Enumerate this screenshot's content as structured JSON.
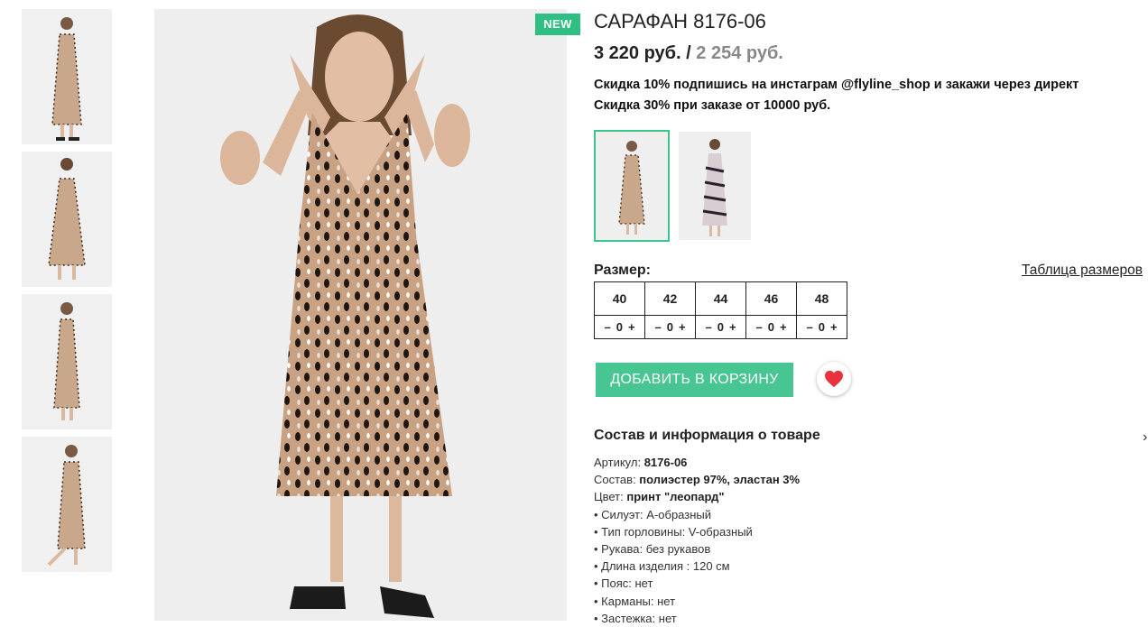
{
  "badge": {
    "new": "NEW"
  },
  "product": {
    "title": "САРАФАН 8176-06",
    "price_current": "3 220 руб.",
    "price_separator": " / ",
    "price_old": "2 254 руб."
  },
  "promo": {
    "line1": "Скидка 10% подпишись на инстаграм @flyline_shop и закажи через директ",
    "line2": "Скидка 30% при заказе от 10000 руб."
  },
  "size": {
    "label": "Размер:",
    "chart_link": "Таблица размеров",
    "options": [
      {
        "size": "40",
        "minus": "–",
        "qty": "0",
        "plus": "+"
      },
      {
        "size": "42",
        "minus": "–",
        "qty": "0",
        "plus": "+"
      },
      {
        "size": "44",
        "minus": "–",
        "qty": "0",
        "plus": "+"
      },
      {
        "size": "46",
        "minus": "–",
        "qty": "0",
        "plus": "+"
      },
      {
        "size": "48",
        "minus": "–",
        "qty": "0",
        "plus": "+"
      }
    ]
  },
  "actions": {
    "add_to_cart": "ДОБАВИТЬ В КОРЗИНУ"
  },
  "info": {
    "section_title": "Состав и информация о товаре",
    "chevron": "›",
    "article_label": "Артикул: ",
    "article_value": "8176-06",
    "composition_label": "Состав: ",
    "composition_value": "полиэстер 97%, эластан 3%",
    "color_label": "Цвет: ",
    "color_value": "принт \"леопард\"",
    "features": [
      "• Силуэт: А-образный",
      "• Тип горловины: V-образный",
      "•  Рукава: без рукавов",
      "• Длина изделия : 120 см",
      "• Пояс: нет",
      "• Карманы: нет",
      "• Застежка: нет"
    ]
  },
  "colors": {
    "accent": "#47c693",
    "badge": "#2fbf82",
    "heart": "#e8323c"
  }
}
